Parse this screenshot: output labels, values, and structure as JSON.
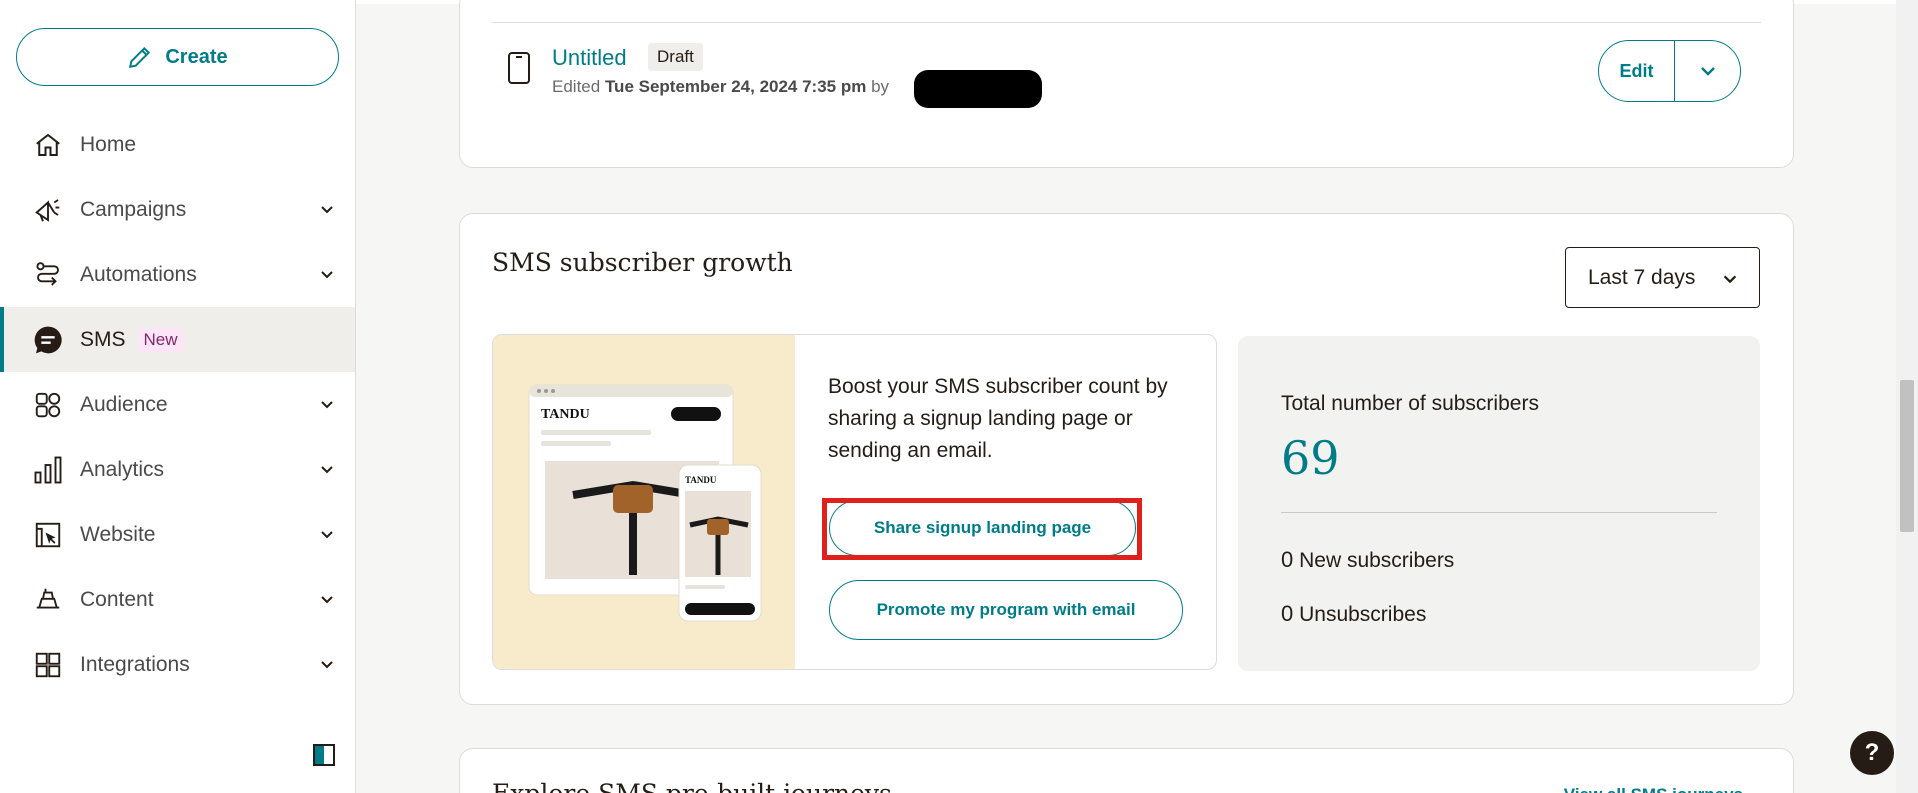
{
  "sidebar": {
    "create_label": "Create",
    "items": [
      {
        "label": "Home",
        "icon": "home-icon",
        "has_chevron": false
      },
      {
        "label": "Campaigns",
        "icon": "megaphone-icon",
        "has_chevron": true
      },
      {
        "label": "Automations",
        "icon": "automation-icon",
        "has_chevron": true
      },
      {
        "label": "SMS",
        "icon": "chat-bubble-icon",
        "has_chevron": false,
        "active": true,
        "badge": "New"
      },
      {
        "label": "Audience",
        "icon": "audience-icon",
        "has_chevron": true
      },
      {
        "label": "Analytics",
        "icon": "bar-chart-icon",
        "has_chevron": true
      },
      {
        "label": "Website",
        "icon": "website-icon",
        "has_chevron": true
      },
      {
        "label": "Content",
        "icon": "content-icon",
        "has_chevron": true
      },
      {
        "label": "Integrations",
        "icon": "grid-icon",
        "has_chevron": true
      }
    ]
  },
  "campaign": {
    "title": "Untitled",
    "status": "Draft",
    "edited_prefix": "Edited",
    "edited_date": "Tue September 24, 2024 7:35 pm",
    "edited_by": "by",
    "edit_label": "Edit"
  },
  "growth": {
    "title": "SMS subscriber growth",
    "range": "Last 7 days",
    "promo_text": "Boost your SMS subscriber count by sharing a signup landing page or sending an email.",
    "share_button": "Share signup landing page",
    "promote_button": "Promote my program with email",
    "art_brand": "TANDU",
    "stats": {
      "total_label": "Total number of subscribers",
      "total_value": "69",
      "new_value": "0",
      "new_label": "New subscribers",
      "unsub_value": "0",
      "unsub_label": "Unsubscribes"
    }
  },
  "explore": {
    "title": "Explore SMS pre-built journeys",
    "view_all": "View all SMS journeys"
  },
  "help_label": "?",
  "colors": {
    "accent": "#007c89",
    "highlight": "#e0201b",
    "art_bg": "#f8ebcc"
  }
}
